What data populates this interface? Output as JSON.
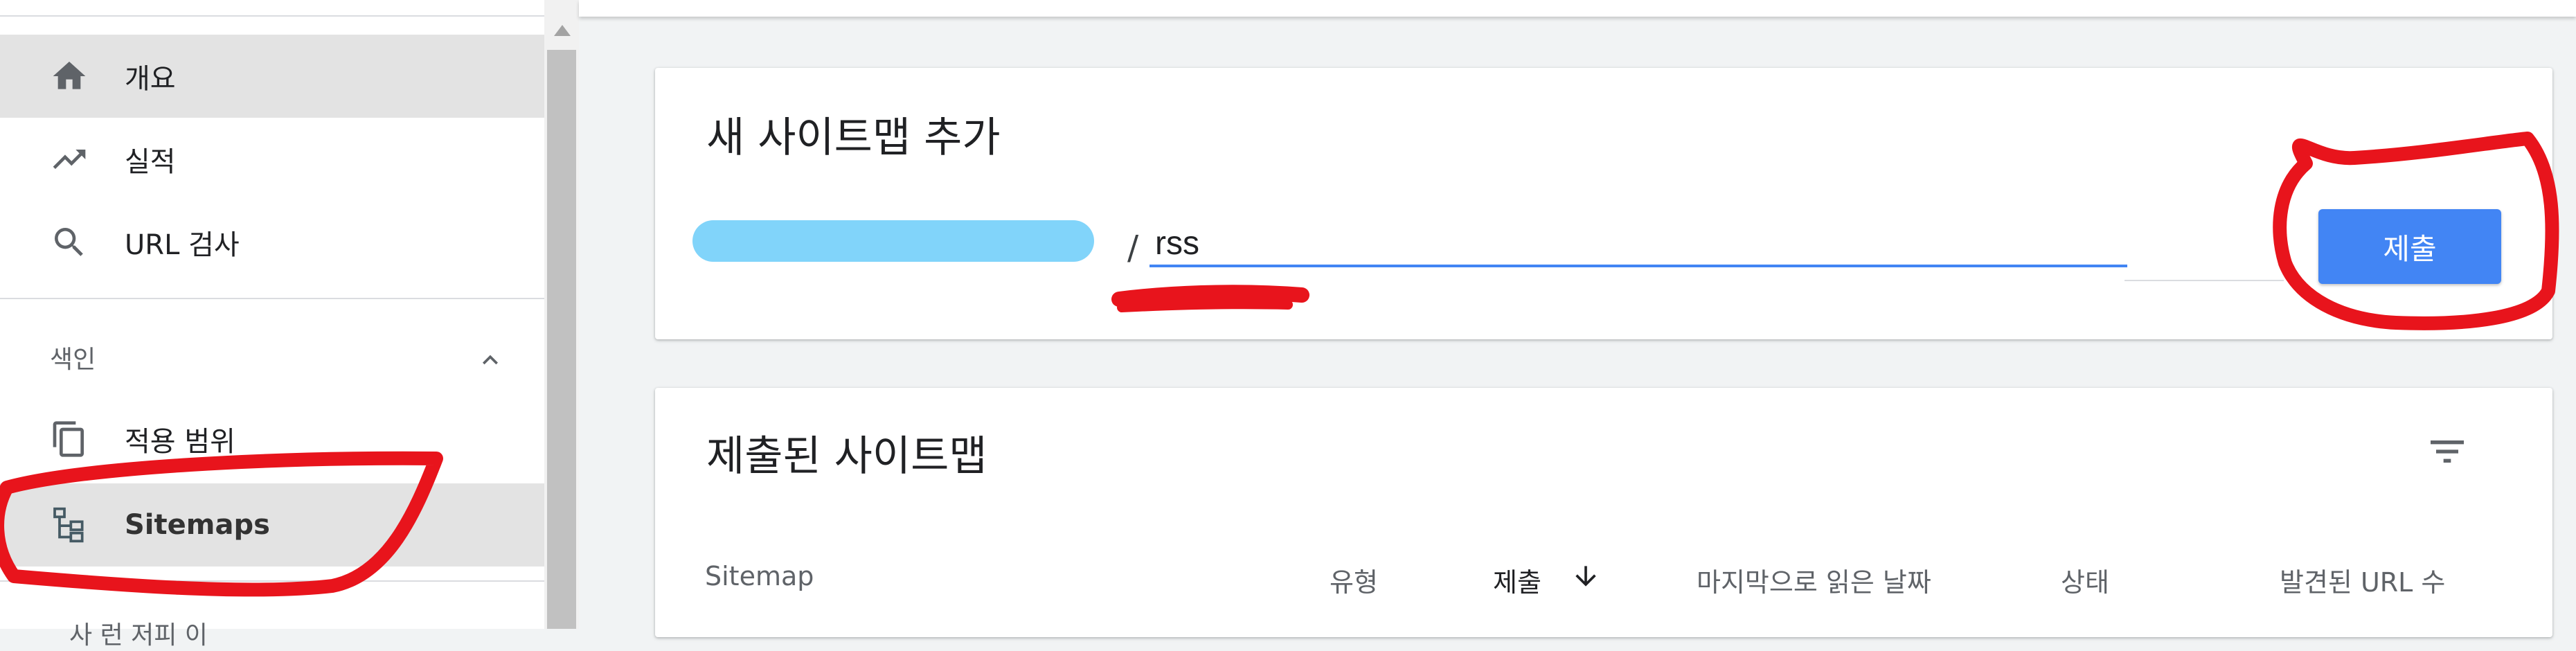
{
  "sidebar": {
    "nav_items": [
      {
        "label": "개요",
        "icon": "home-icon",
        "selected": true
      },
      {
        "label": "실적",
        "icon": "trending-up-icon",
        "selected": false
      },
      {
        "label": "URL 검사",
        "icon": "search-icon",
        "selected": false
      }
    ],
    "index_section": {
      "header": "색인",
      "items": [
        {
          "label": "적용 범위",
          "icon": "copy-icon"
        },
        {
          "label": "Sitemaps",
          "icon": "sitemap-icon"
        }
      ]
    },
    "cut_off_text": "사 런 저피 이"
  },
  "add_sitemap": {
    "title": "새 사이트맵 추가",
    "url_separator": "/",
    "input_value": "rss",
    "submit_label": "제출"
  },
  "submitted_sitemaps": {
    "title": "제출된 사이트맵",
    "columns": [
      "Sitemap",
      "유형",
      "제출",
      "마지막으로 읽은 날짜",
      "상태",
      "발견된 URL 수"
    ],
    "sorted_column": "제출"
  },
  "colors": {
    "accent": "#4285f4",
    "annotation": "#e8141c",
    "redaction": "#81d4fa"
  }
}
